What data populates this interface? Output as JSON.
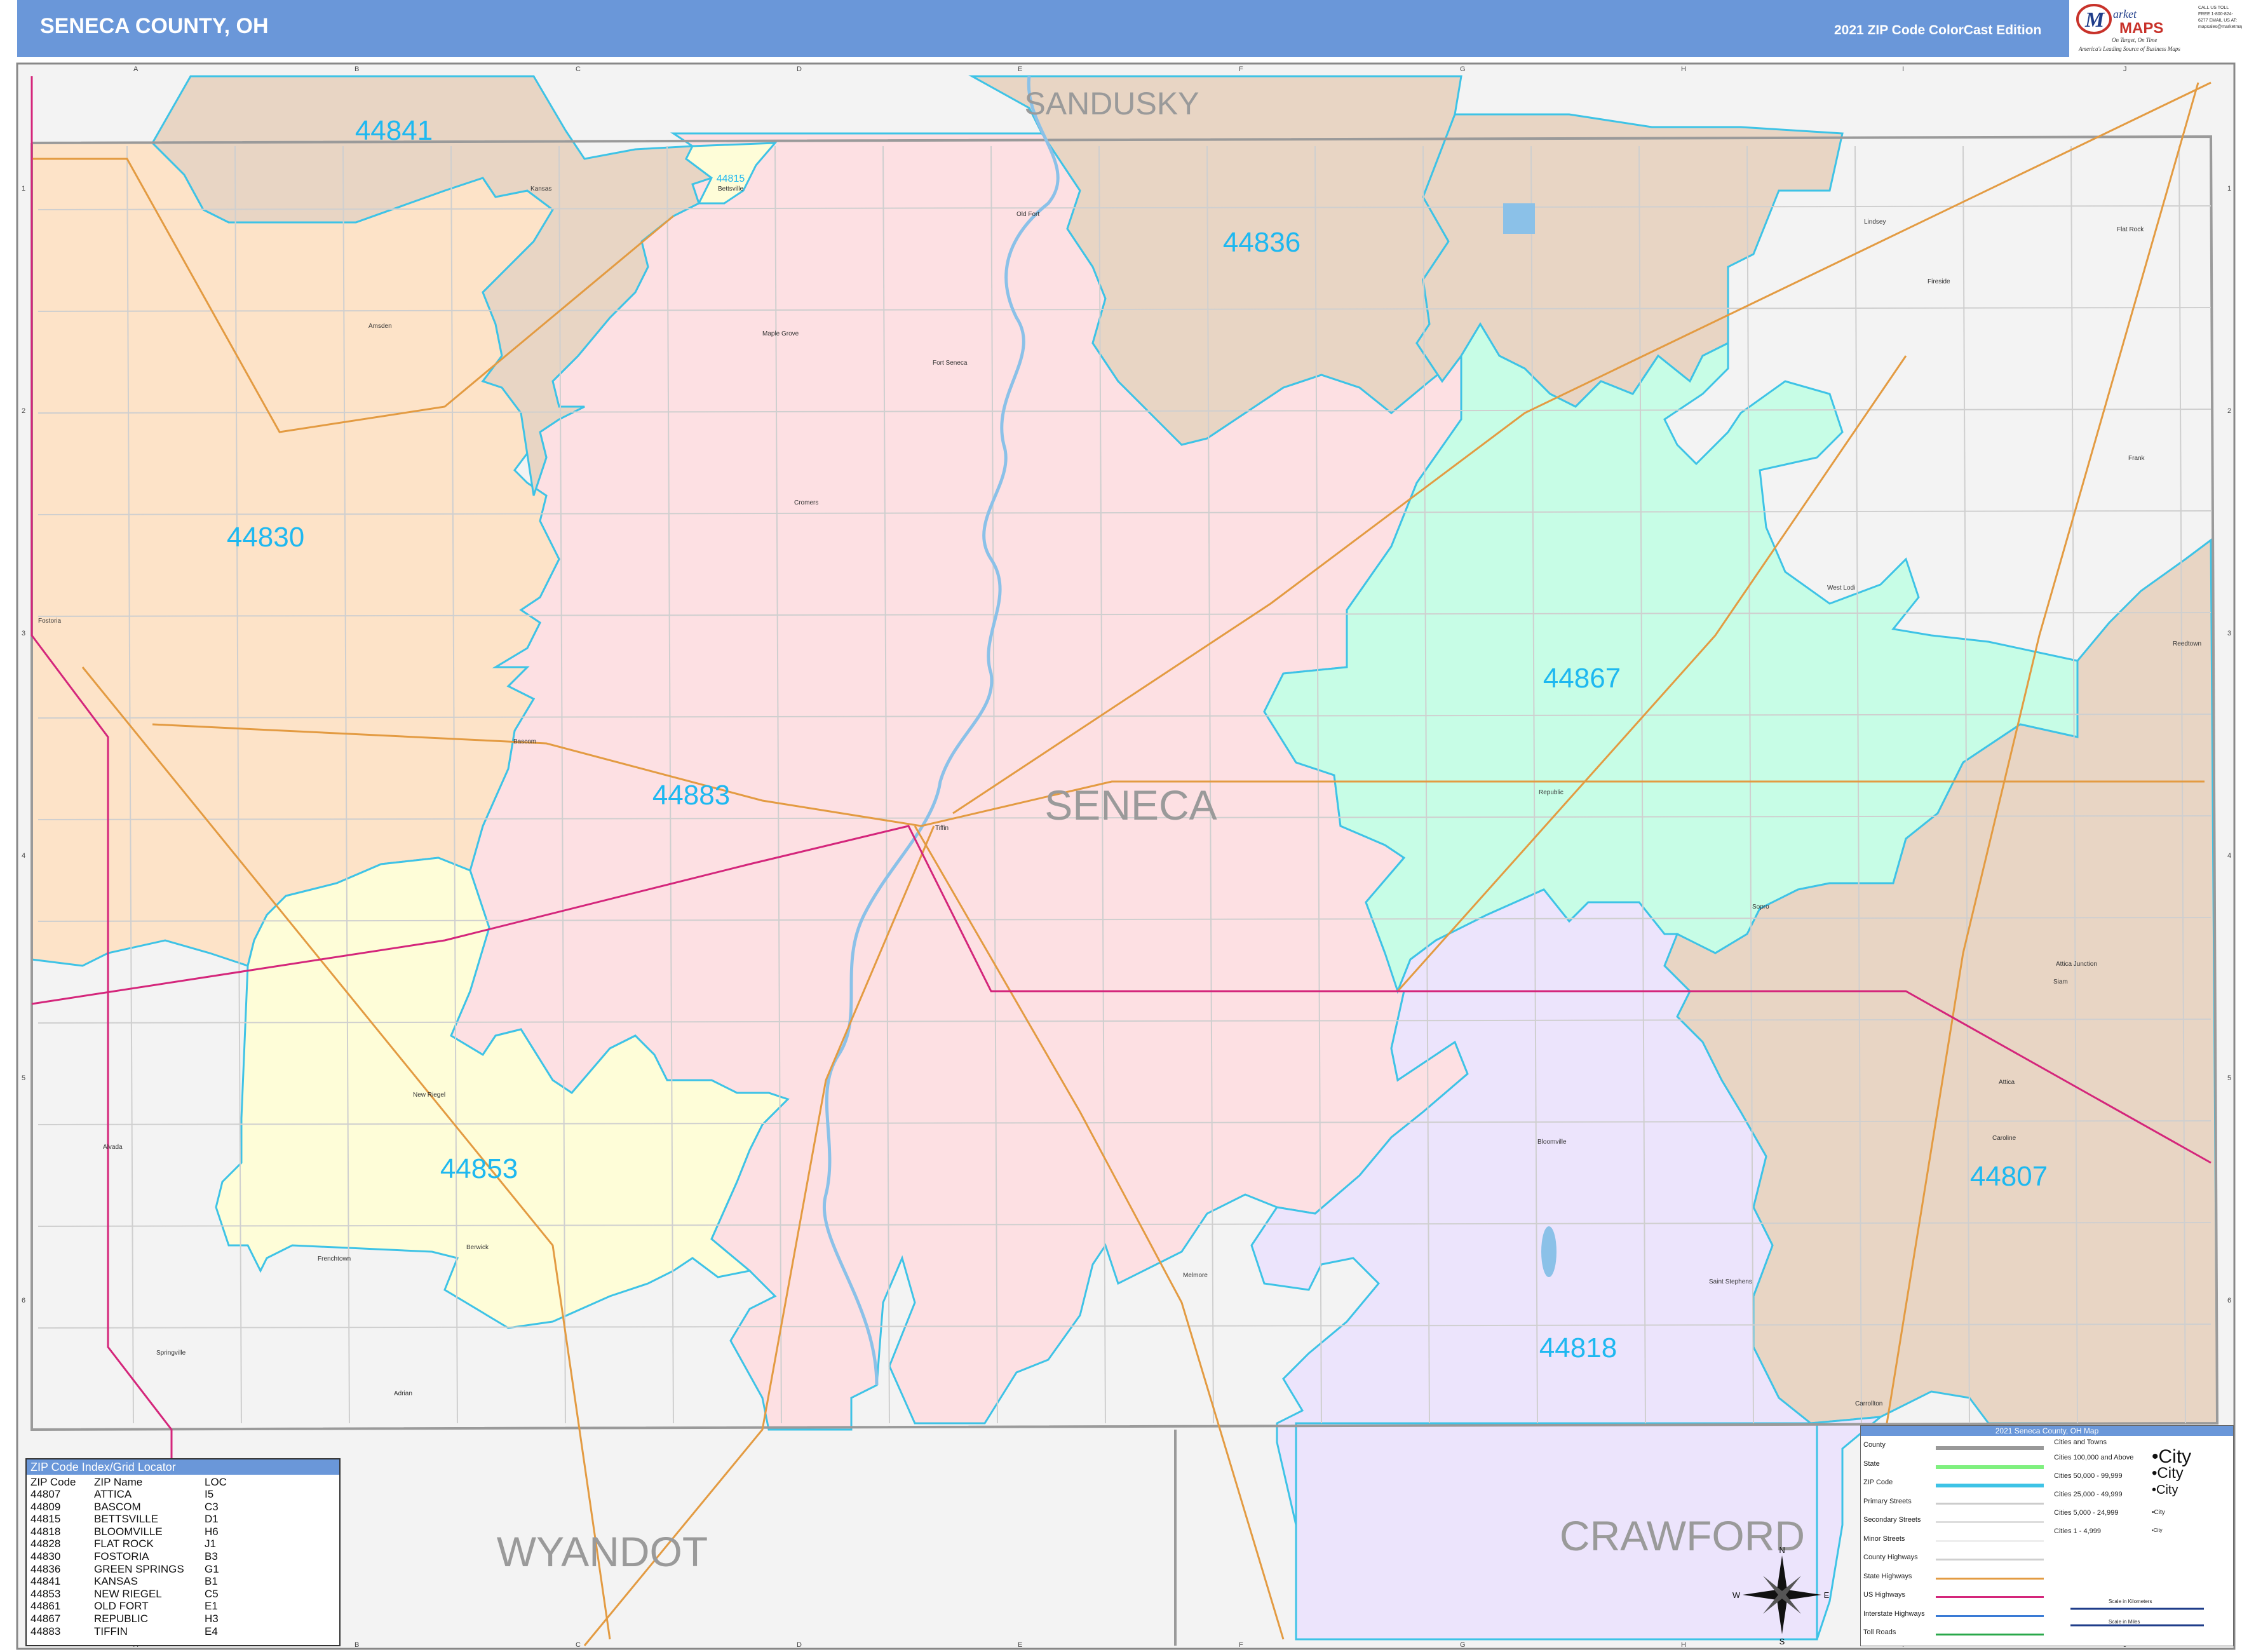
{
  "header": {
    "title": "SENECA COUNTY, OH",
    "edition": "2021 ZIP Code ColorCast Edition",
    "logo_text": "Market MAPS",
    "logo_tagline": "America's Leading Source of Business Maps",
    "logo_sub": "On Target, On Time",
    "contact": "CALL US TOLL FREE 1-800-824-6277  EMAIL US AT: mapsales@marketmaps.com"
  },
  "colors": {
    "header": "#6a97d9",
    "zip_border": "#3ec3e6",
    "zip_label": "#1eb8f0",
    "zip_44830": "#fde3c8",
    "zip_44841": "#e8d5c4",
    "zip_44836": "#e8d5c4",
    "zip_44883": "#fde0e3",
    "zip_44867": "#c7fde6",
    "zip_44853": "#fefdd8",
    "zip_44818": "#ece4fc",
    "zip_44807": "#e8d5c4",
    "outside": "#f3f3f3",
    "us_highway": "#d4267b",
    "state_highway": "#e39b42",
    "river": "#8bc1e8"
  },
  "map": {
    "county_label": "SENECA",
    "neighbor_counties": [
      "SANDUSKY",
      "WYANDOT",
      "CRAWFORD"
    ],
    "zip_labels": [
      "44841",
      "44836",
      "44830",
      "44867",
      "44883",
      "44853",
      "44807",
      "44818"
    ],
    "towns": [
      "Kansas",
      "Bettsville",
      "Old Fort",
      "Amsden",
      "Maple Grove",
      "Fort Seneca",
      "Cromers",
      "Fostoria",
      "Bascom",
      "Tiffin",
      "Republic",
      "Sopro",
      "Attica",
      "Carrollton",
      "Saint Stephens",
      "Bloomville",
      "Melmore",
      "New Riegel",
      "Alvada",
      "Berwick",
      "Frenchtown",
      "Springville",
      "Adrian",
      "Fireside",
      "Frank",
      "West Lodi",
      "Reedtown",
      "Attica Junction",
      "Siam",
      "Flat Rock",
      "Caroline",
      "Lindsey",
      "Flat Rock"
    ],
    "grid_cols": [
      "A",
      "B",
      "C",
      "D",
      "E",
      "F",
      "G",
      "H",
      "I",
      "J"
    ],
    "grid_rows": [
      "1",
      "2",
      "3",
      "4",
      "5",
      "6"
    ],
    "small_zip": "44815"
  },
  "index": {
    "title": "ZIP Code Index/Grid Locator",
    "headers": [
      "ZIP Code",
      "ZIP Name",
      "LOC"
    ],
    "rows": [
      [
        "44807",
        "ATTICA",
        "I5"
      ],
      [
        "44809",
        "BASCOM",
        "C3"
      ],
      [
        "44815",
        "BETTSVILLE",
        "D1"
      ],
      [
        "44818",
        "BLOOMVILLE",
        "H6"
      ],
      [
        "44828",
        "FLAT ROCK",
        "J1"
      ],
      [
        "44830",
        "FOSTORIA",
        "B3"
      ],
      [
        "44836",
        "GREEN SPRINGS",
        "G1"
      ],
      [
        "44841",
        "KANSAS",
        "B1"
      ],
      [
        "44853",
        "NEW RIEGEL",
        "C5"
      ],
      [
        "44861",
        "OLD FORT",
        "E1"
      ],
      [
        "44867",
        "REPUBLIC",
        "H3"
      ],
      [
        "44883",
        "TIFFIN",
        "E4"
      ]
    ]
  },
  "legend": {
    "title": "2021 Seneca County, OH Map",
    "left_items": [
      "County",
      "State",
      "ZIP Code",
      "Primary Streets",
      "Secondary Streets",
      "Minor Streets",
      "County Highways",
      "State Highways",
      "US Highways",
      "Interstate Highways",
      "Toll Roads"
    ],
    "right_header": "Cities and Towns",
    "city_items": [
      "Cities 100,000 and Above",
      "Cities 50,000 - 99,999",
      "Cities 25,000 - 49,999",
      "Cities 5,000 - 24,999",
      "Cities 1 - 4,999"
    ],
    "city_samples": [
      "City",
      "City",
      "City",
      "City",
      "City"
    ],
    "scale_km": "Scale in Kilometers",
    "scale_mi": "Scale in Miles"
  },
  "compass": {
    "n": "N",
    "s": "S",
    "e": "E",
    "w": "W"
  }
}
